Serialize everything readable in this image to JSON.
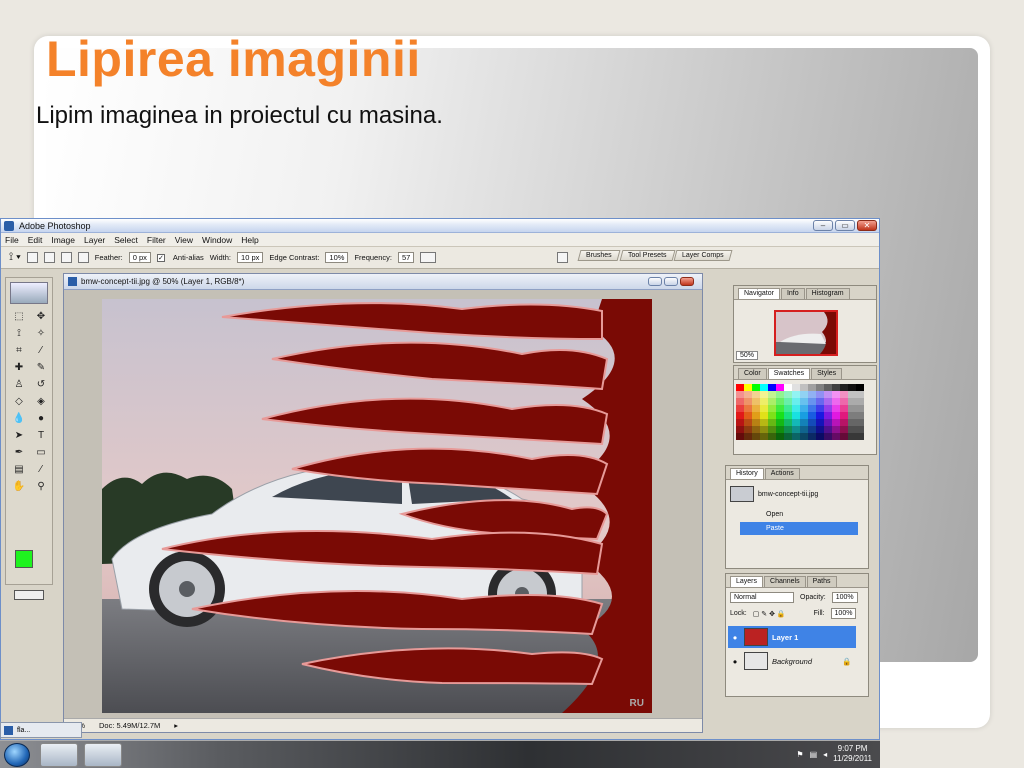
{
  "slide": {
    "title": "Lipirea imaginii",
    "subtitle": "Lipim imaginea in proiectul cu masina."
  },
  "window": {
    "title": "Adobe Photoshop",
    "menu": [
      "File",
      "Edit",
      "Image",
      "Layer",
      "Select",
      "Filter",
      "View",
      "Window",
      "Help"
    ]
  },
  "options": {
    "feather_label": "Feather:",
    "feather_value": "0 px",
    "antialias_label": "Anti-alias",
    "width_label": "Width:",
    "width_value": "10 px",
    "edge_label": "Edge Contrast:",
    "edge_value": "10%",
    "freq_label": "Frequency:",
    "freq_value": "57",
    "well_tabs": [
      "Brushes",
      "Tool Presets",
      "Layer Comps"
    ]
  },
  "document": {
    "title": "bmw-concept-tii.jpg @ 50% (Layer 1, RGB/8*)",
    "zoom": "50%",
    "doc_info": "Doc: 5.49M/12.7M",
    "watermark": "RU"
  },
  "navigator": {
    "tabs": [
      "Navigator",
      "Info",
      "Histogram"
    ],
    "zoom": "50%"
  },
  "swatches": {
    "tabs": [
      "Color",
      "Swatches",
      "Styles"
    ]
  },
  "history": {
    "tabs": [
      "History",
      "Actions"
    ],
    "snapshot": "bmw-concept-tii.jpg",
    "items": [
      "Open",
      "Paste"
    ]
  },
  "layers": {
    "tabs": [
      "Layers",
      "Channels",
      "Paths"
    ],
    "blend_mode": "Normal",
    "opacity_label": "Opacity:",
    "opacity": "100%",
    "lock_label": "Lock:",
    "fill_label": "Fill:",
    "fill": "100%",
    "items": [
      "Layer 1",
      "Background"
    ]
  },
  "taskbar": {
    "mini_label": "fla...",
    "time": "9:07 PM",
    "date": "11/29/2011"
  },
  "colors": {
    "title_orange": "#f4822a",
    "foreground": "#1ff31f",
    "selection_blue": "#3f83e6",
    "flame_red": "#7a0a05"
  }
}
